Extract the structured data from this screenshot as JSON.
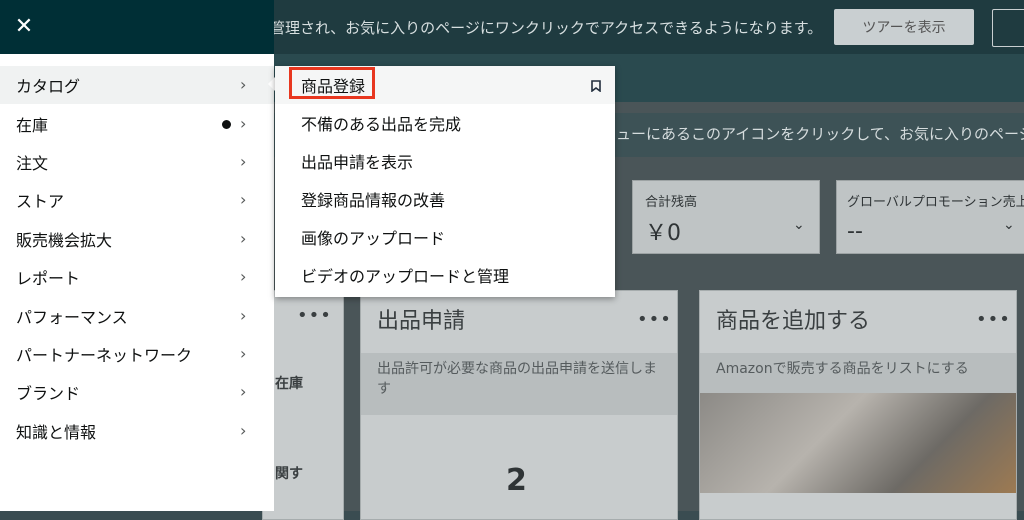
{
  "background": {
    "banner_text": "管理され、お気に入りのページにワンクリックでアクセスできるようになります。",
    "tour_button": "ツアーを表示",
    "hint_text": "ューにあるこのアイコンをクリックして、お気に入りのページ",
    "metrics": [
      {
        "title": "合計残高",
        "value": "￥0"
      },
      {
        "title": "グローバルプロモーション売上",
        "value": "--"
      }
    ],
    "tiles": [
      {
        "title": "出品申請",
        "desc": "出品許可が必要な商品の出品申請を送信します",
        "value": "2"
      },
      {
        "title": "商品を追加する",
        "desc": "Amazonで販売する商品をリストにする"
      }
    ],
    "left_partial": [
      "在庫",
      "関す"
    ]
  },
  "sidebar": {
    "close_icon": "close-icon",
    "items": [
      {
        "label": "カタログ"
      },
      {
        "label": "在庫"
      },
      {
        "label": "注文"
      },
      {
        "label": "ストア"
      },
      {
        "label": "販売機会拡大"
      },
      {
        "label": "レポート"
      },
      {
        "label": "パフォーマンス"
      },
      {
        "label": "パートナーネットワーク"
      },
      {
        "label": "ブランド"
      },
      {
        "label": "知識と情報"
      }
    ]
  },
  "submenu": {
    "items": [
      {
        "label": "商品登録"
      },
      {
        "label": "不備のある出品を完成"
      },
      {
        "label": "出品申請を表示"
      },
      {
        "label": "登録商品情報の改善"
      },
      {
        "label": "画像のアップロード"
      },
      {
        "label": "ビデオのアップロードと管理"
      }
    ]
  },
  "colors": {
    "header": "#002f36",
    "highlight": "#e8371f"
  }
}
